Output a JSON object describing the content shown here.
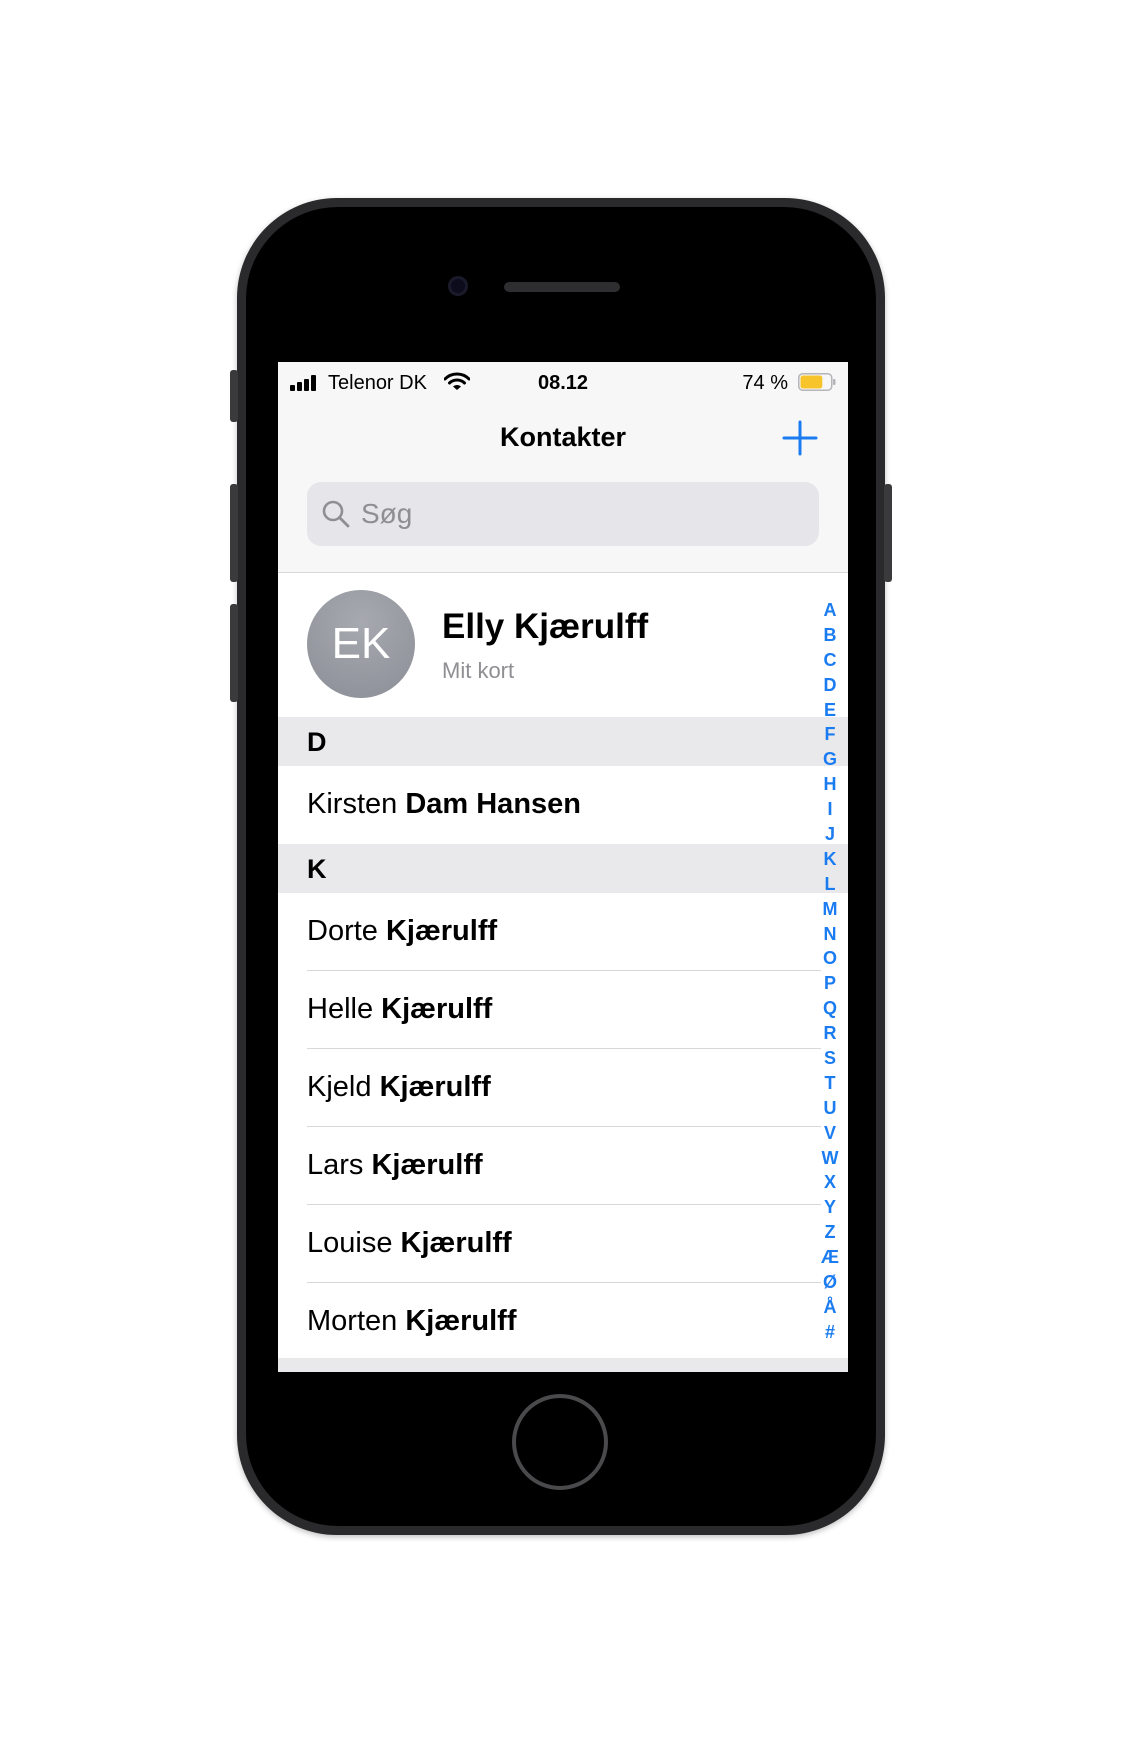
{
  "status_bar": {
    "carrier": "Telenor DK",
    "time": "08.12",
    "battery_percent": "74 %",
    "battery_level": 0.74,
    "battery_color": "#f7c42b"
  },
  "nav": {
    "title": "Kontakter",
    "add_icon": "plus-icon",
    "accent_color": "#1a7cf0"
  },
  "search": {
    "placeholder": "Søg",
    "icon": "search-icon"
  },
  "my_card": {
    "initials": "EK",
    "name": "Elly Kjærulff",
    "subtitle": "Mit kort"
  },
  "sections": [
    {
      "letter": "D",
      "contacts": [
        {
          "first": "Kirsten",
          "last": "Dam Hansen"
        }
      ]
    },
    {
      "letter": "K",
      "contacts": [
        {
          "first": "Dorte",
          "last": "Kjærulff"
        },
        {
          "first": "Helle",
          "last": "Kjærulff"
        },
        {
          "first": "Kjeld",
          "last": "Kjærulff"
        },
        {
          "first": "Lars",
          "last": "Kjærulff"
        },
        {
          "first": "Louise",
          "last": "Kjærulff"
        },
        {
          "first": "Morten",
          "last": "Kjærulff"
        }
      ]
    }
  ],
  "index_letters": [
    "A",
    "B",
    "C",
    "D",
    "E",
    "F",
    "G",
    "H",
    "I",
    "J",
    "K",
    "L",
    "M",
    "N",
    "O",
    "P",
    "Q",
    "R",
    "S",
    "T",
    "U",
    "V",
    "W",
    "X",
    "Y",
    "Z",
    "Æ",
    "Ø",
    "Å",
    "#"
  ]
}
